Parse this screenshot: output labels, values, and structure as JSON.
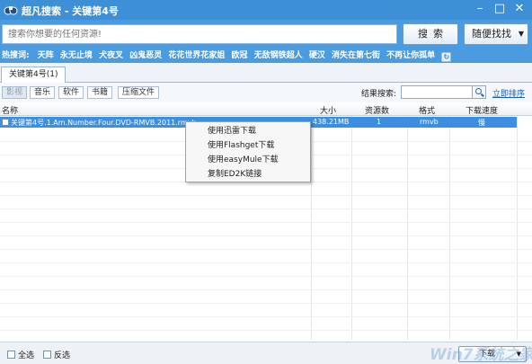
{
  "window": {
    "title": "超凡搜索 - 关键第4号",
    "controls": [
      "minimize",
      "maximize",
      "close"
    ]
  },
  "search": {
    "placeholder": "搜索你想要的任何资源!",
    "search_button": "搜索",
    "random_button": "随便找找"
  },
  "hotwords": {
    "label": "热搜词:",
    "items": [
      "天阵",
      "永无止境",
      "犬夜叉",
      "凶鬼恶灵",
      "花花世界花家姐",
      "欧冠",
      "无敌钢铁超人",
      "硬汉",
      "消失在第七街",
      "不再让你孤单"
    ]
  },
  "tabs": [
    {
      "label": "关键第4号(1)"
    }
  ],
  "filters": [
    "影视",
    "音乐",
    "软件",
    "书籍",
    "压缩文件"
  ],
  "result_search": {
    "label": "结果搜索:",
    "sort_link": "立即排序"
  },
  "table": {
    "columns": [
      "名称",
      "大小",
      "资源数",
      "格式",
      "下载速度"
    ],
    "rows": [
      {
        "name": "关键第4号.1.Am.Number.Four.DVD-RMVB.2011.rmvb",
        "size": "438.21MB",
        "sources": "1",
        "format": "rmvb",
        "speed": "慢"
      }
    ]
  },
  "context_menu": {
    "items": [
      "使用迅雷下载",
      "使用Flashget下载",
      "使用easyMule下载",
      "复制ED2K链接"
    ]
  },
  "bottom": {
    "select_all": "全选",
    "invert": "反选",
    "download_button": "下载"
  },
  "watermark": "Win7系统之家"
}
